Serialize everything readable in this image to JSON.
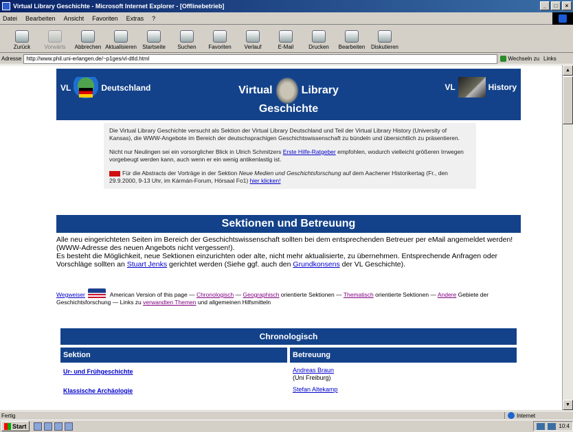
{
  "window": {
    "title": "Virtual Library Geschichte - Microsoft Internet Explorer - [Offlinebetrieb]"
  },
  "menu": [
    "Datei",
    "Bearbeiten",
    "Ansicht",
    "Favoriten",
    "Extras",
    "?"
  ],
  "toolbar": [
    {
      "label": "Zurück",
      "icon": "back-icon",
      "enabled": true
    },
    {
      "label": "Vorwärts",
      "icon": "forward-icon",
      "enabled": false
    },
    {
      "label": "Abbrechen",
      "icon": "stop-icon",
      "enabled": true
    },
    {
      "label": "Aktualisieren",
      "icon": "refresh-icon",
      "enabled": true
    },
    {
      "label": "Startseite",
      "icon": "home-icon",
      "enabled": true
    },
    {
      "label": "Suchen",
      "icon": "search-icon",
      "enabled": true
    },
    {
      "label": "Favoriten",
      "icon": "favorites-icon",
      "enabled": true
    },
    {
      "label": "Verlauf",
      "icon": "history-icon",
      "enabled": true
    },
    {
      "label": "E-Mail",
      "icon": "mail-icon",
      "enabled": true
    },
    {
      "label": "Drucken",
      "icon": "print-icon",
      "enabled": true
    },
    {
      "label": "Bearbeiten",
      "icon": "edit-icon",
      "enabled": true
    },
    {
      "label": "Diskutieren",
      "icon": "discuss-icon",
      "enabled": true
    }
  ],
  "address": {
    "label": "Adresse",
    "value": "http://www.phil.uni-erlangen.de/~p1ges/vl-dtld.html",
    "go": "Wechseln zu",
    "links": "Links"
  },
  "banner": {
    "left": "Deutschland",
    "left_prefix": "VL",
    "center_top_left": "Virtual",
    "center_top_right": "Library",
    "center_bottom": "Geschichte",
    "right_prefix": "VL",
    "right": "History"
  },
  "intro": {
    "p1": "Die Virtual Library Geschichte versucht als Sektion der Virtual Library Deutschland und Teil der Virtual Library History (University of Kansas), die WWW-Angebote im Bereich der deutschsprachigen Geschichtswissenschaft zu bündeln und übersichtlich zu präsentieren.",
    "p2_pre": "Nicht nur Neulingen sei ein vorsorglicher Blick in Ulrich Schmitzers ",
    "p2_link": "Erste Hilfe-Ratgeber",
    "p2_post": " empfohlen, wodurch vielleicht größeren Irrwegen vorgebeugt werden kann, auch wenn er ein wenig antikenlastig ist.",
    "p3_pre": "Für die Abstracts der Vorträge in der Sektion ",
    "p3_em": "Neue Medien und Geschichtsforschung",
    "p3_mid": " auf dem Aachener Historikertag (Fr., den 29.9.2000, 9-13 Uhr, im Kármán-Forum, Hörsaal Fo1) ",
    "p3_link": "hier klicken!"
  },
  "sections": {
    "title": "Sektionen und Betreuung",
    "text1": "Alle neu eingerichteten Seiten im Bereich der Geschichtswissenschaft sollten bei dem entsprechenden Betreuer per eMail angemeldet werden! (WWW-Adresse des neuen Angebots nicht vergessen!).",
    "text2_pre": "Es besteht die Möglichkeit, neue Sektionen einzurichten oder alte, nicht mehr aktualisierte, zu übernehmen. Entsprechende Anfragen oder Vorschläge sollten an ",
    "text2_link1": "Stuart Jenks",
    "text2_mid": " gerichtet werden (Siehe ggf. auch den ",
    "text2_link2": "Grundkonsens",
    "text2_post": " der VL Geschichte)."
  },
  "wegweiser": {
    "label": "Wegweiser",
    "t1": " American Version of this page — ",
    "l1": "Chronologisch",
    "t2": " — ",
    "l2": "Geographisch",
    "t3": " orientierte Sektionen — ",
    "l3": "Thematisch",
    "t4": " orientierte Sektionen — ",
    "l4": "Andere",
    "t5": " Gebiete der Geschichtsforschung — Links zu ",
    "l5": "verwandten Themen",
    "t6": " und allgemeinen Hilfsmitteln"
  },
  "chrono": {
    "title": "Chronologisch",
    "col1": "Sektion",
    "col2": "Betreuung",
    "rows": [
      {
        "section": "Ur- und Frühgeschichte",
        "name": "Andreas Braun",
        "org": "(Uni Freiburg)"
      },
      {
        "section": "Klassische Archäologie",
        "name": "Stefan Altekamp",
        "org": ""
      }
    ]
  },
  "status": {
    "text": "Fertig",
    "zone": "Internet"
  },
  "taskbar": {
    "start": "Start",
    "tray": "10:4"
  }
}
